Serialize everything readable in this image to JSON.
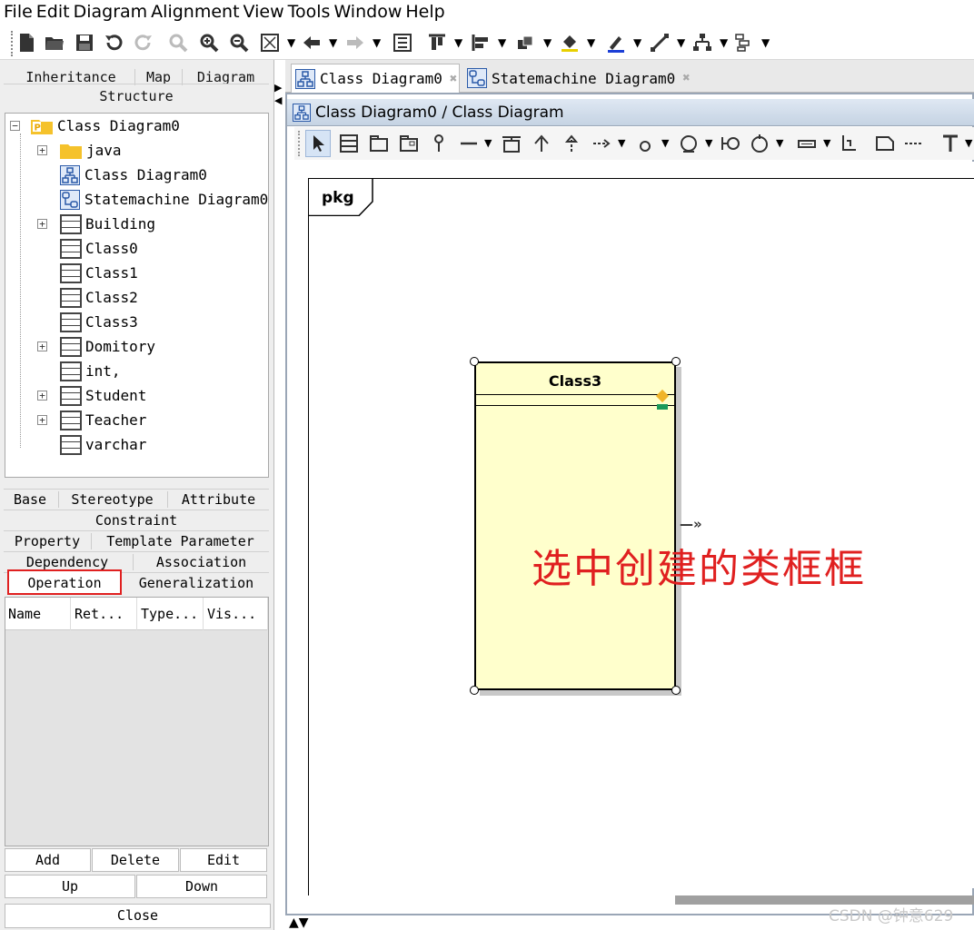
{
  "menu": [
    "File",
    "Edit",
    "Diagram",
    "Alignment",
    "View",
    "Tools",
    "Window",
    "Help"
  ],
  "left_tabs": {
    "inheritance": "Inheritance",
    "map": "Map",
    "diagram": "Diagram",
    "structure": "Structure"
  },
  "tree": {
    "root": "Class Diagram0",
    "items": [
      {
        "label": "java",
        "icon": "folder-icon",
        "expandable": true
      },
      {
        "label": "Class Diagram0",
        "icon": "class-diagram-icon",
        "expandable": false
      },
      {
        "label": "Statemachine Diagram0",
        "icon": "statemachine-diagram-icon",
        "expandable": false
      },
      {
        "label": "Building",
        "icon": "class-icon",
        "expandable": true
      },
      {
        "label": "Class0",
        "icon": "class-icon",
        "expandable": false
      },
      {
        "label": "Class1",
        "icon": "class-icon",
        "expandable": false
      },
      {
        "label": "Class2",
        "icon": "class-icon",
        "expandable": false
      },
      {
        "label": "Class3",
        "icon": "class-icon",
        "expandable": false
      },
      {
        "label": "Domitory",
        "icon": "class-icon",
        "expandable": true
      },
      {
        "label": "int,",
        "icon": "class-icon",
        "expandable": false
      },
      {
        "label": "Student",
        "icon": "class-icon",
        "expandable": true
      },
      {
        "label": "Teacher",
        "icon": "class-icon",
        "expandable": true
      },
      {
        "label": "varchar",
        "icon": "class-icon",
        "expandable": false
      }
    ]
  },
  "prop_tabs": {
    "base": "Base",
    "stereotype": "Stereotype",
    "attribute": "Attribute",
    "constraint": "Constraint",
    "property": "Property",
    "template_parameter": "Template Parameter",
    "dependency": "Dependency",
    "association": "Association",
    "operation": "Operation",
    "generalization": "Generalization"
  },
  "ops_table": {
    "columns": [
      "Name",
      "Ret...",
      "Type...",
      "Vis..."
    ]
  },
  "buttons": {
    "add": "Add",
    "delete": "Delete",
    "edit": "Edit",
    "up": "Up",
    "down": "Down",
    "close": "Close"
  },
  "doc_tabs": [
    "Class Diagram0",
    "Statemachine Diagram0"
  ],
  "editor_title": "Class Diagram0 / Class Diagram",
  "canvas": {
    "pkg_label": "pkg",
    "class_name": "Class3",
    "annotation": "选中创建的类框框"
  },
  "watermark": "CSDN @钟意629",
  "colors": {
    "class_fill": "#ffffcc",
    "annotation": "#e02020",
    "highlight_box": "#e02020",
    "title_bar": "#c5d3e3"
  }
}
